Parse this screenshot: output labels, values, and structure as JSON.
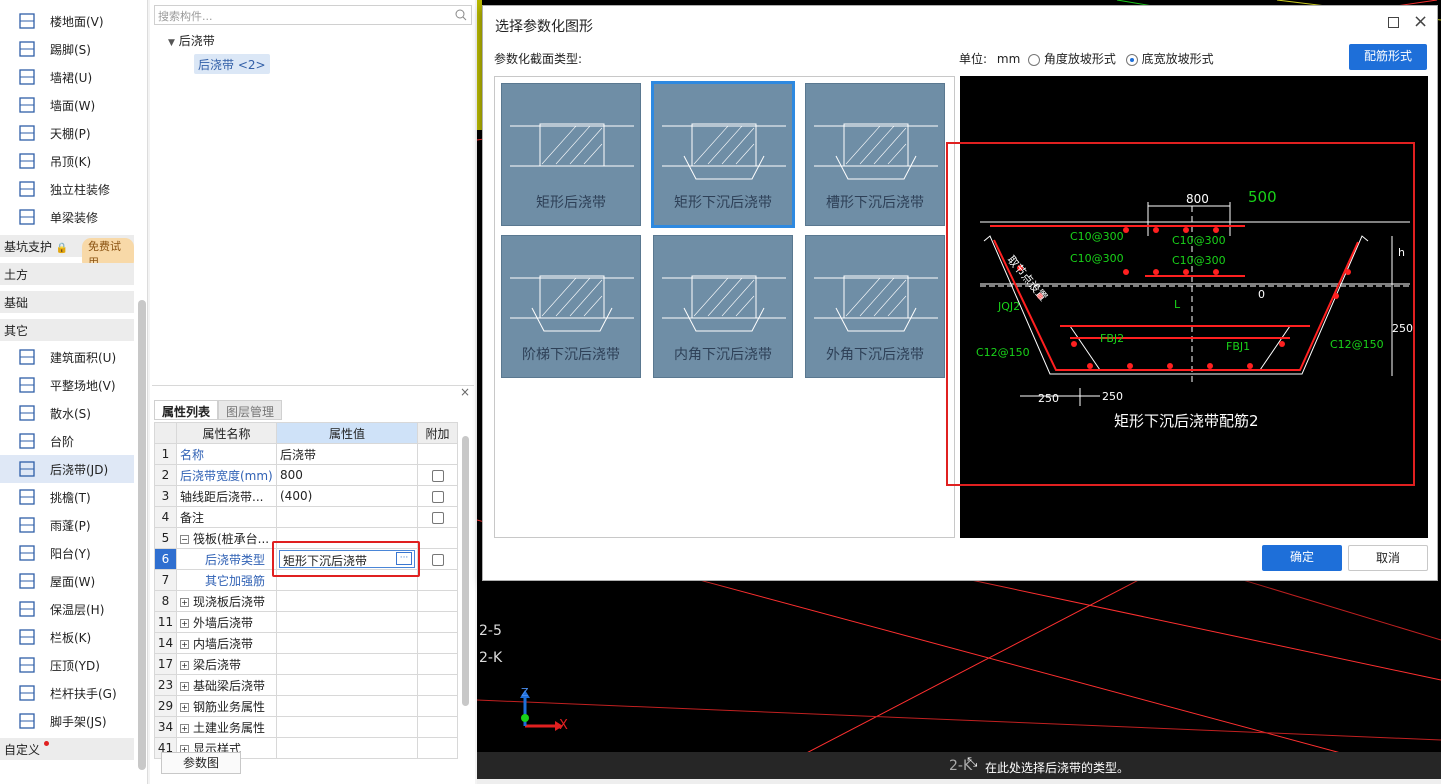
{
  "sidebar": {
    "items_top": [
      {
        "label": "楼地面(V)",
        "icon": "floor-icon"
      },
      {
        "label": "踢脚(S)",
        "icon": "skirting-icon"
      },
      {
        "label": "墙裙(U)",
        "icon": "wainscot-icon"
      },
      {
        "label": "墙面(W)",
        "icon": "wall-face-icon"
      },
      {
        "label": "天棚(P)",
        "icon": "ceiling-icon"
      },
      {
        "label": "吊顶(K)",
        "icon": "suspended-ceiling-icon"
      },
      {
        "label": "独立柱装修",
        "icon": "column-decoration-icon"
      },
      {
        "label": "单梁装修",
        "icon": "beam-decoration-icon"
      }
    ],
    "category_pit": "基坑支护",
    "trial_badge": "免费试用",
    "category_earth": "土方",
    "category_foundation": "基础",
    "category_other": "其它",
    "items_other": [
      {
        "label": "建筑面积(U)",
        "icon": "building-area-icon"
      },
      {
        "label": "平整场地(V)",
        "icon": "site-leveling-icon"
      },
      {
        "label": "散水(S)",
        "icon": "apron-icon"
      },
      {
        "label": "台阶",
        "icon": "steps-icon"
      },
      {
        "label": "后浇带(JD)",
        "icon": "post-cast-strip-icon"
      },
      {
        "label": "挑檐(T)",
        "icon": "cornice-icon"
      },
      {
        "label": "雨蓬(P)",
        "icon": "canopy-icon"
      },
      {
        "label": "阳台(Y)",
        "icon": "balcony-icon"
      },
      {
        "label": "屋面(W)",
        "icon": "roof-icon"
      },
      {
        "label": "保温层(H)",
        "icon": "insulation-icon"
      },
      {
        "label": "栏板(K)",
        "icon": "parapet-icon"
      },
      {
        "label": "压顶(YD)",
        "icon": "coping-icon"
      },
      {
        "label": "栏杆扶手(G)",
        "icon": "railing-icon"
      },
      {
        "label": "脚手架(JS)",
        "icon": "scaffold-icon"
      }
    ],
    "category_custom": "自定义"
  },
  "component_panel": {
    "search_placeholder": "搜索构件...",
    "tree_root": "后浇带",
    "tree_child": "后浇带 <2>"
  },
  "properties": {
    "tab_list": "属性列表",
    "tab_layers": "图层管理",
    "headers": {
      "name": "属性名称",
      "value": "属性值",
      "extra": "附加"
    },
    "rows": [
      {
        "num": "1",
        "name": "名称",
        "value": "后浇带",
        "check": false,
        "blue": true
      },
      {
        "num": "2",
        "name": "后浇带宽度(mm)",
        "value": "800",
        "check": true,
        "blue": true
      },
      {
        "num": "3",
        "name": "轴线距后浇带...",
        "value": "(400)",
        "check": true
      },
      {
        "num": "4",
        "name": "备注",
        "value": "",
        "check": true
      },
      {
        "num": "5",
        "name": "筏板(桩承台...",
        "value": "",
        "expand": "−"
      },
      {
        "num": "6",
        "name": "后浇带类型",
        "value": "矩形下沉后浇带",
        "check": true,
        "blue": true,
        "indent": true,
        "selected": true
      },
      {
        "num": "7",
        "name": "其它加强筋",
        "value": "",
        "blue": true,
        "indent": true
      },
      {
        "num": "8",
        "name": "现浇板后浇带",
        "value": "",
        "expand": "+"
      },
      {
        "num": "11",
        "name": "外墙后浇带",
        "value": "",
        "expand": "+"
      },
      {
        "num": "14",
        "name": "内墙后浇带",
        "value": "",
        "expand": "+"
      },
      {
        "num": "17",
        "name": "梁后浇带",
        "value": "",
        "expand": "+"
      },
      {
        "num": "23",
        "name": "基础梁后浇带",
        "value": "",
        "expand": "+"
      },
      {
        "num": "29",
        "name": "钢筋业务属性",
        "value": "",
        "expand": "+"
      },
      {
        "num": "34",
        "name": "土建业务属性",
        "value": "",
        "expand": "+"
      },
      {
        "num": "41",
        "name": "显示样式",
        "value": "",
        "expand": "+"
      }
    ],
    "param_button": "参数图"
  },
  "dialog": {
    "title": "选择参数化图形",
    "section_label": "参数化截面类型:",
    "unit_label": "单位:",
    "unit_value": "mm",
    "radio_angle": "角度放坡形式",
    "radio_width": "底宽放坡形式",
    "rebar_button": "配筋形式",
    "ok": "确定",
    "cancel": "取消",
    "thumbnails": [
      "矩形后浇带",
      "矩形下沉后浇带",
      "槽形下沉后浇带",
      "阶梯下沉后浇带",
      "内角下沉后浇带",
      "外角下沉后浇带"
    ],
    "preview": {
      "dim_800": "800",
      "dim_500": "500",
      "c10_a": "C10@300",
      "c10_b": "C10@300",
      "c10_c": "C10@300",
      "c10_d": "C10@300",
      "jqj2": "JQJ2",
      "fbj2": "FBJ2",
      "fbj1": "FBJ1",
      "c12_left": "C12@150",
      "c12_right": "C12@150",
      "dim_L": "L",
      "dim_0": "0",
      "dim_h": "h",
      "dim_250_r": "250",
      "dim_250_a": "250",
      "dim_250_b": "250",
      "note": "取节点设置",
      "caption": "矩形下沉后浇带配筋2"
    }
  },
  "cad": {
    "label_25": "2-5",
    "label_2K": "2-K",
    "axis_x": "X",
    "axis_z": "Z",
    "status": "在此处选择后浇带的类型。",
    "status_prefix": "2-K"
  },
  "colors": {
    "accent": "#1e6fd9",
    "highlight": "#e02020",
    "cad_green": "#19d219"
  }
}
